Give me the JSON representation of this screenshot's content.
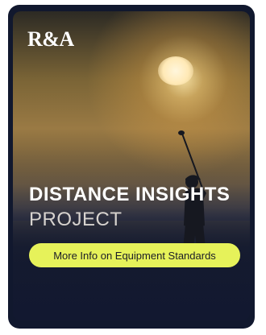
{
  "brand": {
    "logo_text": "R&A"
  },
  "promo": {
    "title": "DISTANCE INSIGHTS",
    "subtitle": "PROJECT",
    "cta_label": "More Info on Equipment Standards"
  },
  "colors": {
    "card_background": "#11182e",
    "cta_background": "#e6f25a",
    "title_text": "#ffffff"
  }
}
